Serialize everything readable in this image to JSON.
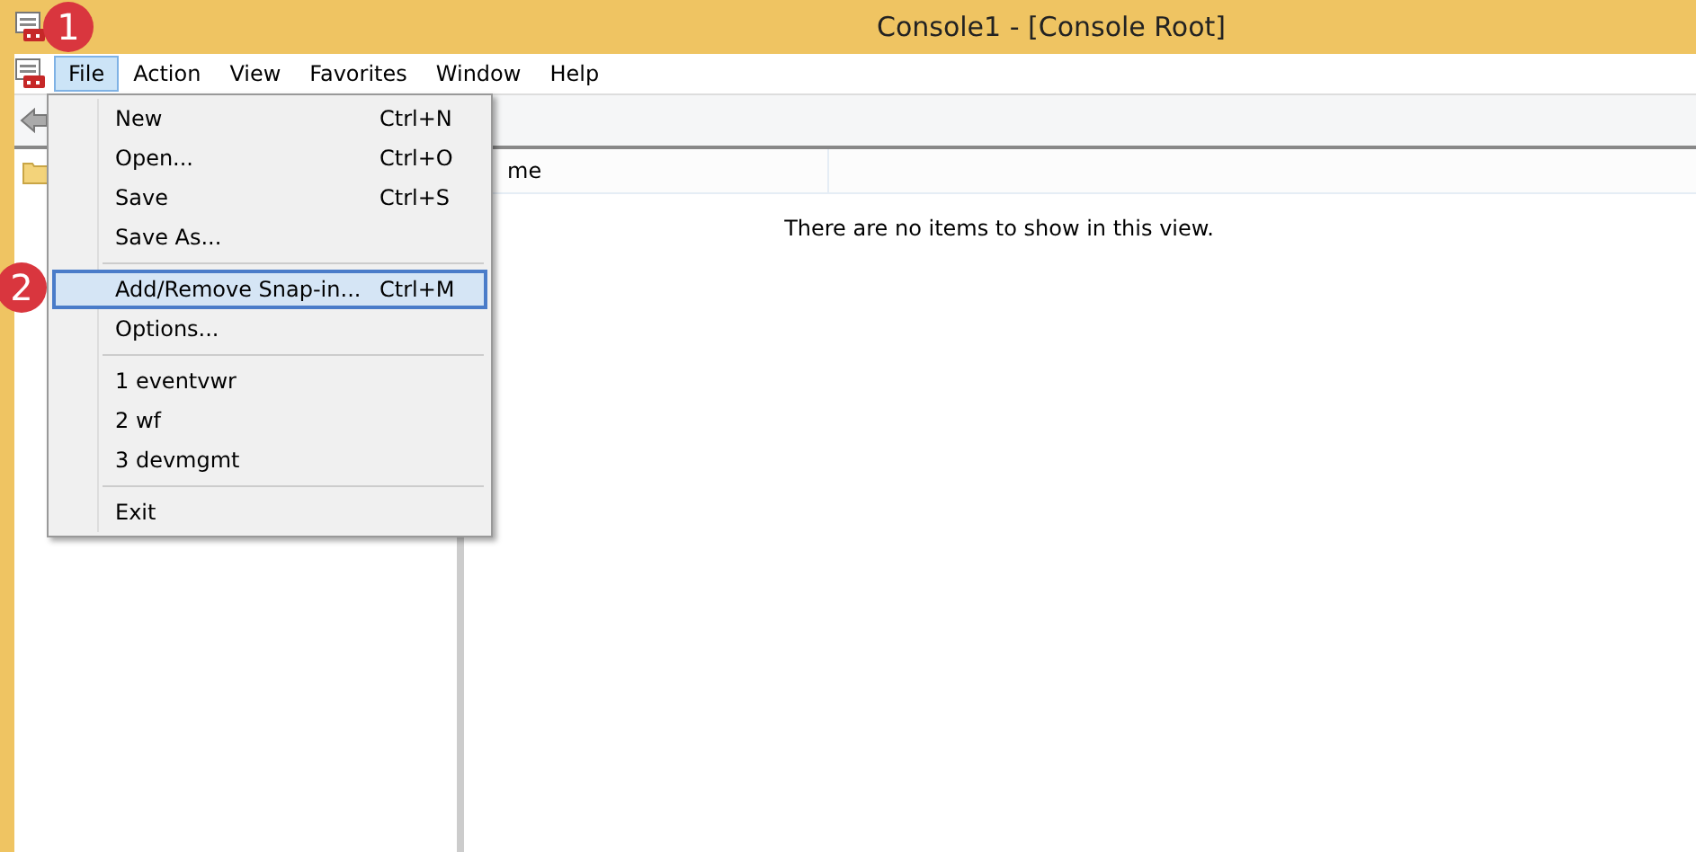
{
  "window": {
    "title": "Console1 - [Console Root]"
  },
  "menu_bar": [
    {
      "label": "File",
      "selected": true
    },
    {
      "label": "Action",
      "selected": false
    },
    {
      "label": "View",
      "selected": false
    },
    {
      "label": "Favorites",
      "selected": false
    },
    {
      "label": "Window",
      "selected": false
    },
    {
      "label": "Help",
      "selected": false
    }
  ],
  "file_menu": [
    {
      "kind": "item",
      "label": "New",
      "shortcut": "Ctrl+N",
      "highlighted": false
    },
    {
      "kind": "item",
      "label": "Open...",
      "shortcut": "Ctrl+O",
      "highlighted": false
    },
    {
      "kind": "item",
      "label": "Save",
      "shortcut": "Ctrl+S",
      "highlighted": false
    },
    {
      "kind": "item",
      "label": "Save As...",
      "highlighted": false
    },
    {
      "kind": "separator"
    },
    {
      "kind": "item",
      "label": "Add/Remove Snap-in...",
      "shortcut": "Ctrl+M",
      "highlighted": true
    },
    {
      "kind": "item",
      "label": "Options...",
      "highlighted": false
    },
    {
      "kind": "separator"
    },
    {
      "kind": "item",
      "label": "1 eventvwr",
      "highlighted": false
    },
    {
      "kind": "item",
      "label": "2 wf",
      "highlighted": false
    },
    {
      "kind": "item",
      "label": "3 devmgmt",
      "highlighted": false
    },
    {
      "kind": "separator"
    },
    {
      "kind": "item",
      "label": "Exit",
      "highlighted": false
    }
  ],
  "step_badges": [
    "1",
    "2"
  ],
  "list_view": {
    "column_header": "me",
    "empty_message": "There are no items to show in this view."
  }
}
